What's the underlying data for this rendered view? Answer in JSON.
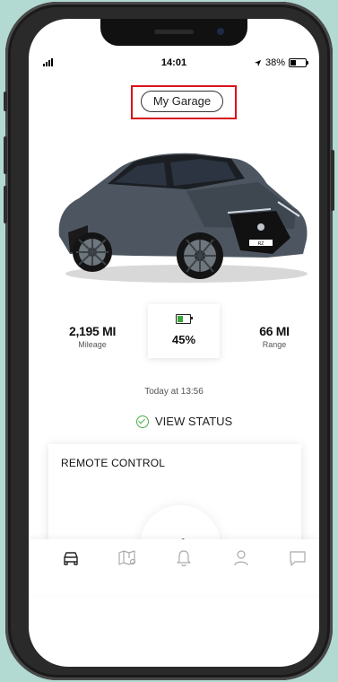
{
  "status_bar": {
    "time": "14:01",
    "battery_percent": "38%",
    "location_icon": "location-arrow-icon",
    "signal_icon": "signal-icon"
  },
  "header": {
    "garage_label": "My Garage"
  },
  "vehicle": {
    "plate_text": "RZ"
  },
  "stats": {
    "mileage_value": "2,195 MI",
    "mileage_label": "Mileage",
    "battery_percent": "45%",
    "range_value": "66 MI",
    "range_label": "Range"
  },
  "timestamp": "Today at 13:56",
  "view_status_label": "VIEW STATUS",
  "remote_control": {
    "title": "REMOTE CONTROL",
    "icon": "fan-icon"
  },
  "bottom_nav": [
    "car-icon",
    "map-icon",
    "bell-icon",
    "profile-icon",
    "chat-icon"
  ],
  "colors": {
    "highlight": "#d9121b",
    "battery_green": "#3aa73a",
    "check_green": "#4cae4c",
    "background": "#b3d9d3"
  }
}
